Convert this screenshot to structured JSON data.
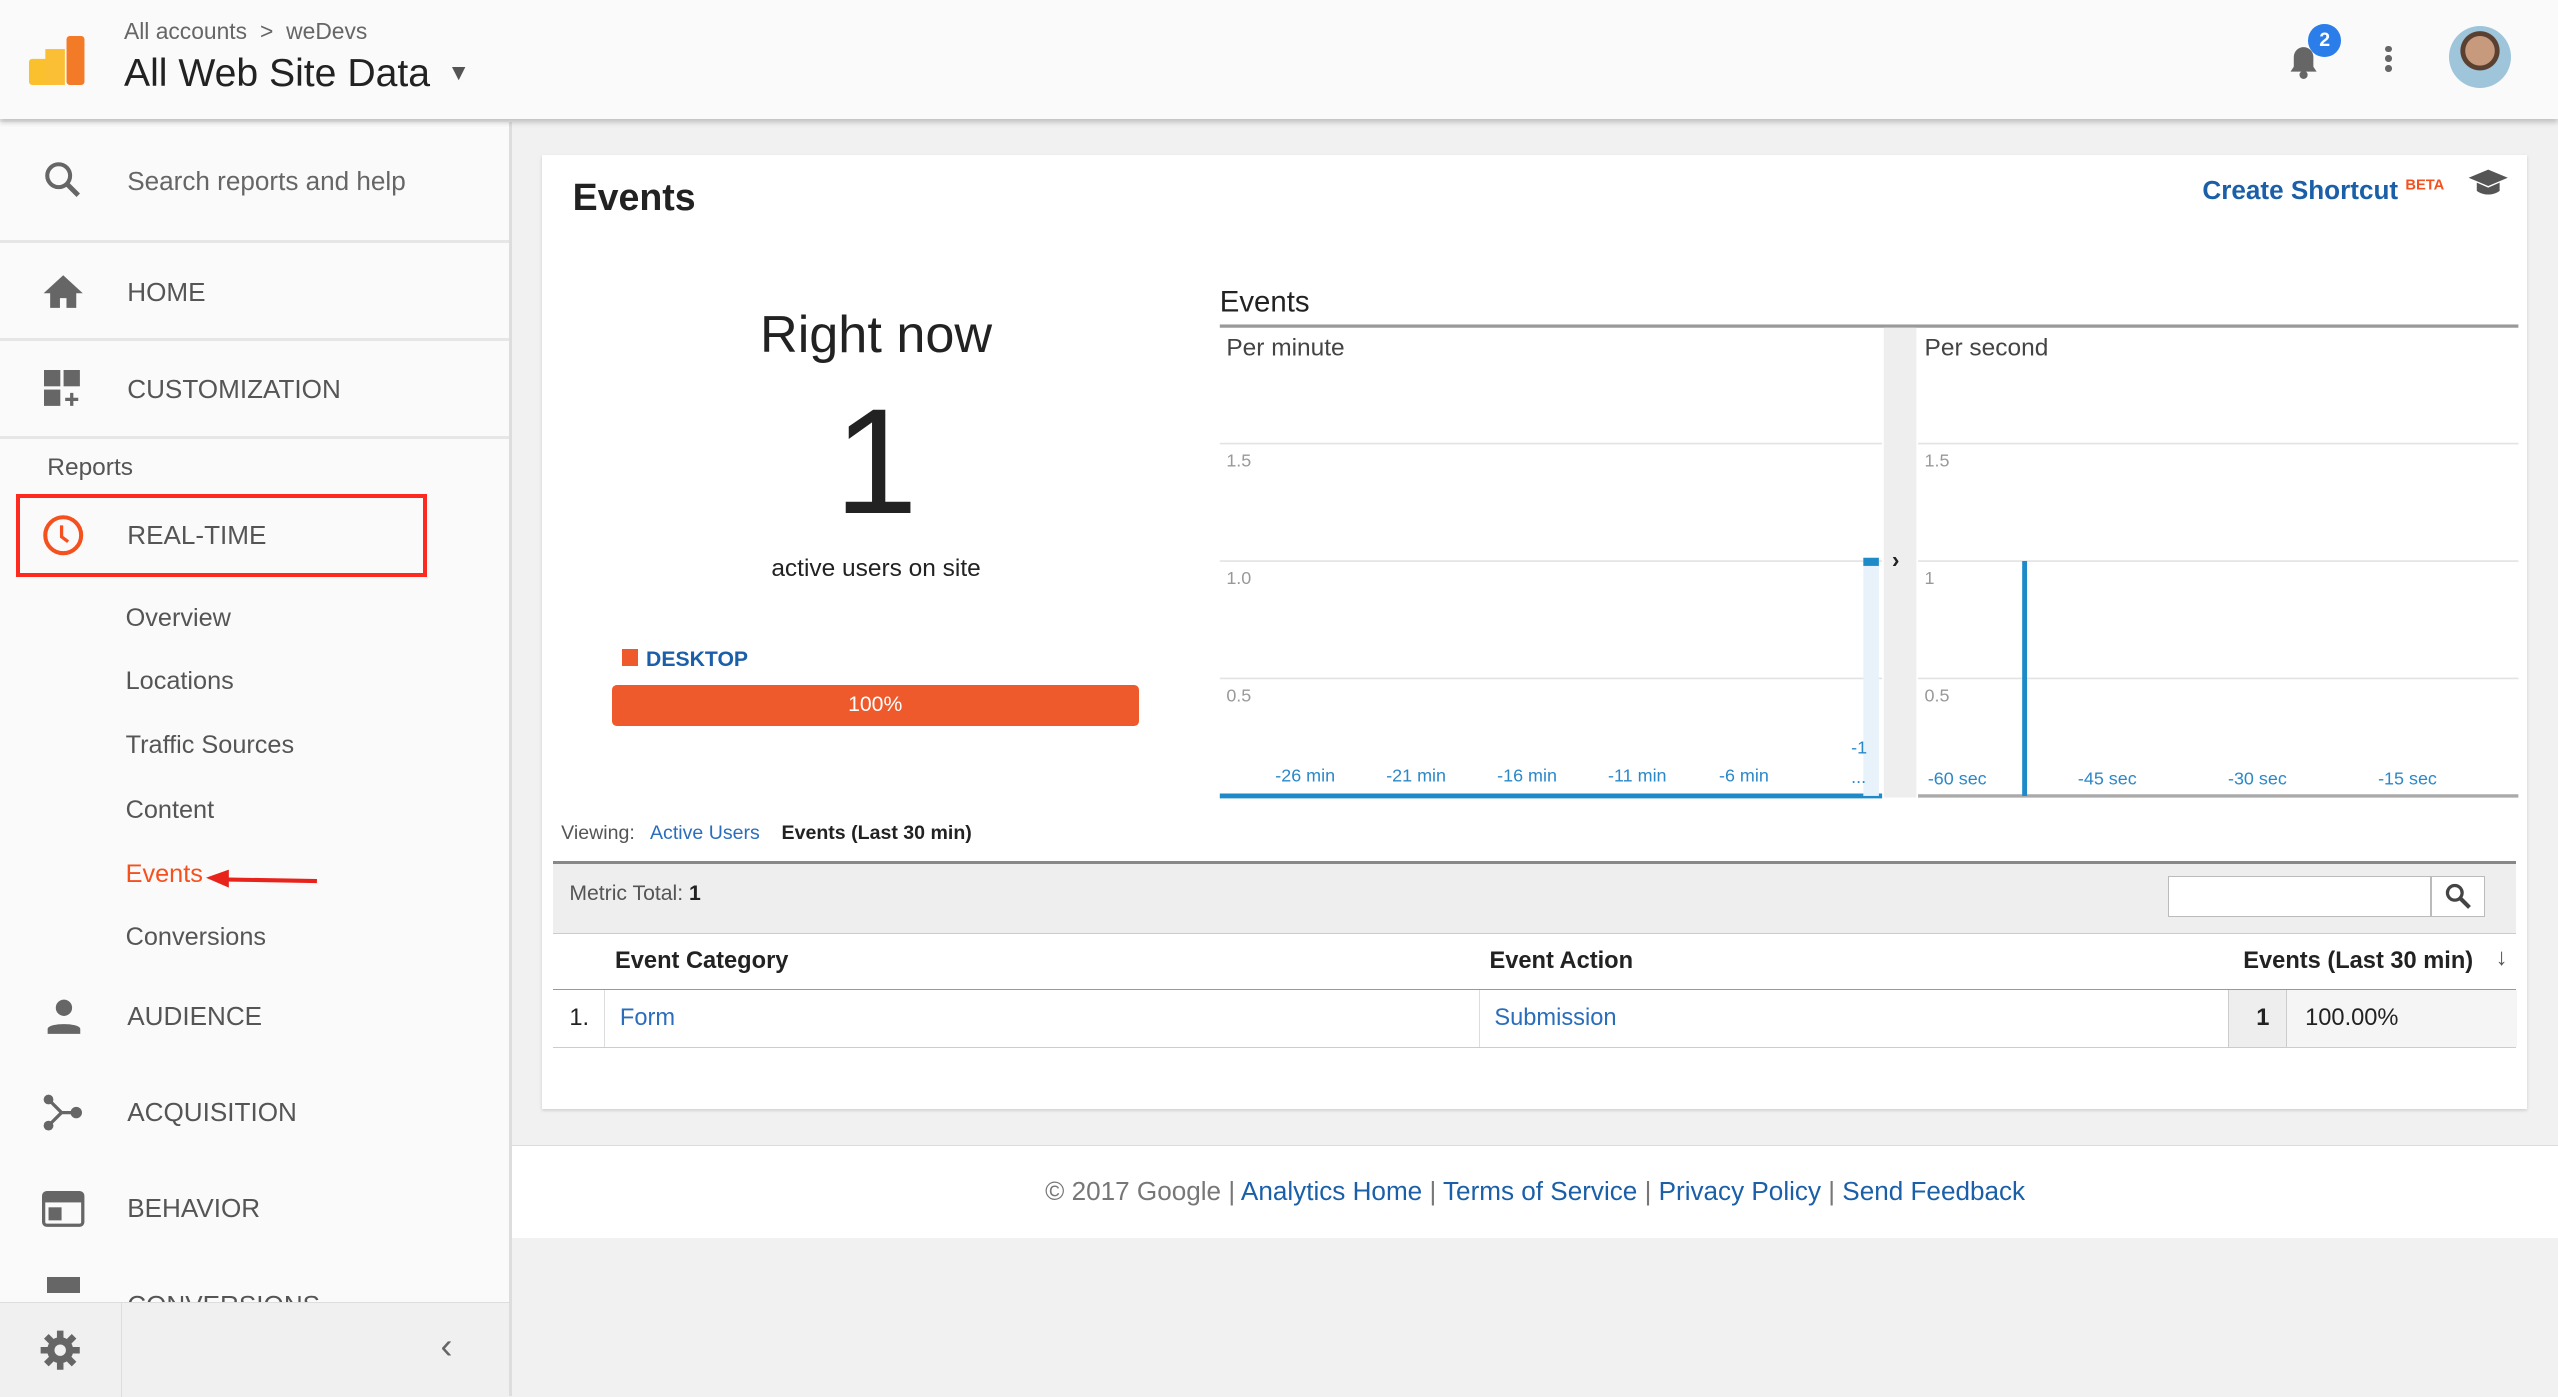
{
  "header": {
    "breadcrumb": [
      "All accounts",
      "weDevs"
    ],
    "breadcrumb_sep": ">",
    "title": "All Web Site Data",
    "notifications_count": "2"
  },
  "sidebar": {
    "search_placeholder": "Search reports and help",
    "home": "HOME",
    "customization": "CUSTOMIZATION",
    "reports_heading": "Reports",
    "realtime": "REAL-TIME",
    "realtime_items": [
      "Overview",
      "Locations",
      "Traffic Sources",
      "Content",
      "Events",
      "Conversions"
    ],
    "audience": "AUDIENCE",
    "acquisition": "ACQUISITION",
    "behavior": "BEHAVIOR",
    "conversions": "CONVERSIONS",
    "active_color": "#f4511e",
    "highlight_color": "#ff2a1f"
  },
  "page": {
    "title": "Events",
    "create_shortcut": "Create Shortcut",
    "beta": "BETA",
    "right_now": "Right now",
    "active_users": "1",
    "active_users_label": "active users on site",
    "device_label": "DESKTOP",
    "device_percent_label": "100%",
    "device_percent": 100,
    "device_color": "#ee5a2c",
    "viewing_label": "Viewing:",
    "viewing_tabs": [
      "Active Users",
      "Events (Last 30 min)"
    ],
    "metric_total_label": "Metric Total:",
    "metric_total": "1",
    "table": {
      "headers": [
        "Event Category",
        "Event Action",
        "Events (Last 30 min)"
      ],
      "rows": [
        {
          "index": "1.",
          "category": "Form",
          "action": "Submission",
          "events": "1",
          "percent": "100.00%"
        }
      ]
    }
  },
  "chart_data": [
    {
      "type": "bar",
      "title": "Events",
      "subtitle": "Per minute",
      "ylim": [
        0,
        1.5
      ],
      "yticks": [
        "0.5",
        "1.0",
        "1.5"
      ],
      "xtick_labels": [
        "-26 min",
        "-21 min",
        "-16 min",
        "-11 min",
        "-6 min",
        "-1 ..."
      ],
      "x": [
        -30,
        -29,
        -28,
        -27,
        -26,
        -25,
        -24,
        -23,
        -22,
        -21,
        -20,
        -19,
        -18,
        -17,
        -16,
        -15,
        -14,
        -13,
        -12,
        -11,
        -10,
        -9,
        -8,
        -7,
        -6,
        -5,
        -4,
        -3,
        -2,
        -1
      ],
      "values": [
        0,
        0,
        0,
        0,
        0,
        0,
        0,
        0,
        0,
        0,
        0,
        0,
        0,
        0,
        0,
        0,
        0,
        0,
        0,
        0,
        0,
        0,
        0,
        0,
        0,
        0,
        0,
        0,
        0,
        1
      ],
      "color": "#1e8bc8"
    },
    {
      "type": "bar",
      "subtitle": "Per second",
      "ylim": [
        0,
        1.5
      ],
      "yticks": [
        "0.5",
        "1",
        "1.5"
      ],
      "xtick_labels": [
        "-60 sec",
        "-45 sec",
        "-30 sec",
        "-15 sec"
      ],
      "x": [
        -50
      ],
      "values": [
        1
      ],
      "color": "#1e8bc8"
    }
  ],
  "footer": {
    "copyright": "© 2017 Google",
    "links": [
      "Analytics Home",
      "Terms of Service",
      "Privacy Policy",
      "Send Feedback"
    ]
  }
}
